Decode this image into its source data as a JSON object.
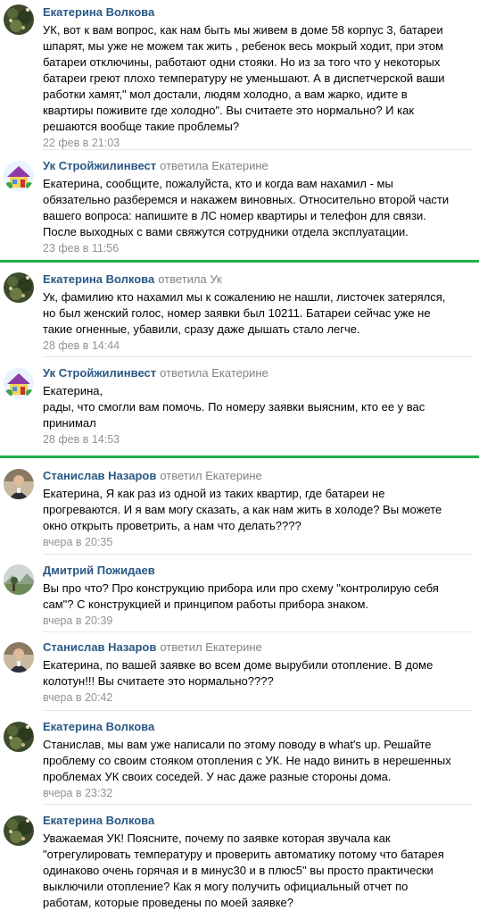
{
  "comments": [
    {
      "author": "Екатерина Волкова",
      "reply_verb": "",
      "reply_target": "",
      "lines": [
        "УК, вот к вам вопрос, как нам быть мы живем в доме 58 корпус 3, батареи",
        "шпарят, мы уже не можем так жить , ребенок весь мокрый ходит, при этом",
        "батареи отключины, работают одни стояки. Но из за того что у некоторых",
        "батареи греют плохо температуру не уменьшают. А в диспетчерской ваши",
        "работки хамят,\" мол достали, людям холодно, а вам жарко, идите в",
        "квартиры поживите где холодно\". Вы считаете это нормально? И как",
        "решаются вообще такие проблемы?"
      ],
      "date": "22 фев в 21:03"
    },
    {
      "author": "Ук Стройжилинвест",
      "reply_verb": "ответила",
      "reply_target": "Екатерине",
      "lines": [
        "Екатерина, сообщите, пожалуйста, кто и когда вам нахамил - мы",
        "обязательно разберемся и накажем виновных. Относительно второй части",
        "вашего вопроса: напишите в ЛС номер квартиры и телефон для связи.",
        "После выходных с вами свяжутся сотрудники отдела эксплуатации."
      ],
      "date": "23 фев в 11:56"
    },
    {
      "author": "Екатерина Волкова",
      "reply_verb": "ответила",
      "reply_target": "Ук",
      "lines": [
        "Ук, фамилию кто нахамил мы к сожалению не нашли, листочек затерялся,",
        "но был женский голос, номер заявки был 10211. Батареи сейчас уже не",
        "такие огненные, убавили, сразу даже дышать стало легче."
      ],
      "date": "28 фев в 14:44"
    },
    {
      "author": "Ук Стройжилинвест",
      "reply_verb": "ответила",
      "reply_target": "Екатерине",
      "lines": [
        "Екатерина,",
        "рады, что смогли вам помочь. По номеру заявки выясним, кто ее у вас",
        "принимал"
      ],
      "date": "28 фев в 14:53"
    },
    {
      "author": "Станислав Назаров",
      "reply_verb": "ответил",
      "reply_target": "Екатерине",
      "lines": [
        "Екатерина, Я как раз из одной из таких квартир, где батареи не",
        "прогреваются. И я вам могу сказать, а как нам жить в холоде? Вы можете",
        "окно открыть проветрить, а нам что делать????"
      ],
      "date": "вчера в 20:35"
    },
    {
      "author": "Дмитрий Пожидаев",
      "reply_verb": "",
      "reply_target": "",
      "lines": [
        "Вы про что? Про конструкцию прибора или про схему \"контролирую себя",
        "сам\"? С конструкцией и принципом работы прибора знаком."
      ],
      "date": "вчера в 20:39"
    },
    {
      "author": "Станислав Назаров",
      "reply_verb": "ответил",
      "reply_target": "Екатерине",
      "lines": [
        "Екатерина, по вашей заявке во всем доме вырубили отопление. В доме",
        "колотун!!! Вы считаете это нормально????"
      ],
      "date": "вчера в 20:42"
    },
    {
      "author": "Екатерина Волкова",
      "reply_verb": "",
      "reply_target": "",
      "lines": [
        "Станислав, мы вам уже написали по этому поводу в what's up. Решайте",
        "проблему со своим стояком отопления с УК. Не надо винить в нерешенных",
        "проблемах УК своих соседей. У нас даже разные стороны дома."
      ],
      "date": "вчера в 23:32"
    },
    {
      "author": "Екатерина Волкова",
      "reply_verb": "",
      "reply_target": "",
      "lines": [
        "Уважаемая УК! Поясните, почему по заявке которая звучала как",
        "\"отрегулировать температуру и проверить автоматику потому что батарея",
        "одинаково очень горячая и в минус30 и в плюс5\" вы просто практически",
        "выключили отопление? Как я могу получить официальный отчет по",
        "работам, которые проведены по моей заявке?"
      ],
      "date": ""
    }
  ],
  "colors": {
    "author": "#2a5885",
    "meta": "#828282",
    "date": "#939393",
    "highlight_line": "#1fb14a",
    "separator": "#e7e8ec"
  },
  "avatar_icons": [
    "tree-photo",
    "cartoon-house",
    "tree-photo",
    "cartoon-house",
    "man-photo",
    "landscape-photo",
    "man-photo",
    "tree-photo",
    "tree-photo"
  ]
}
